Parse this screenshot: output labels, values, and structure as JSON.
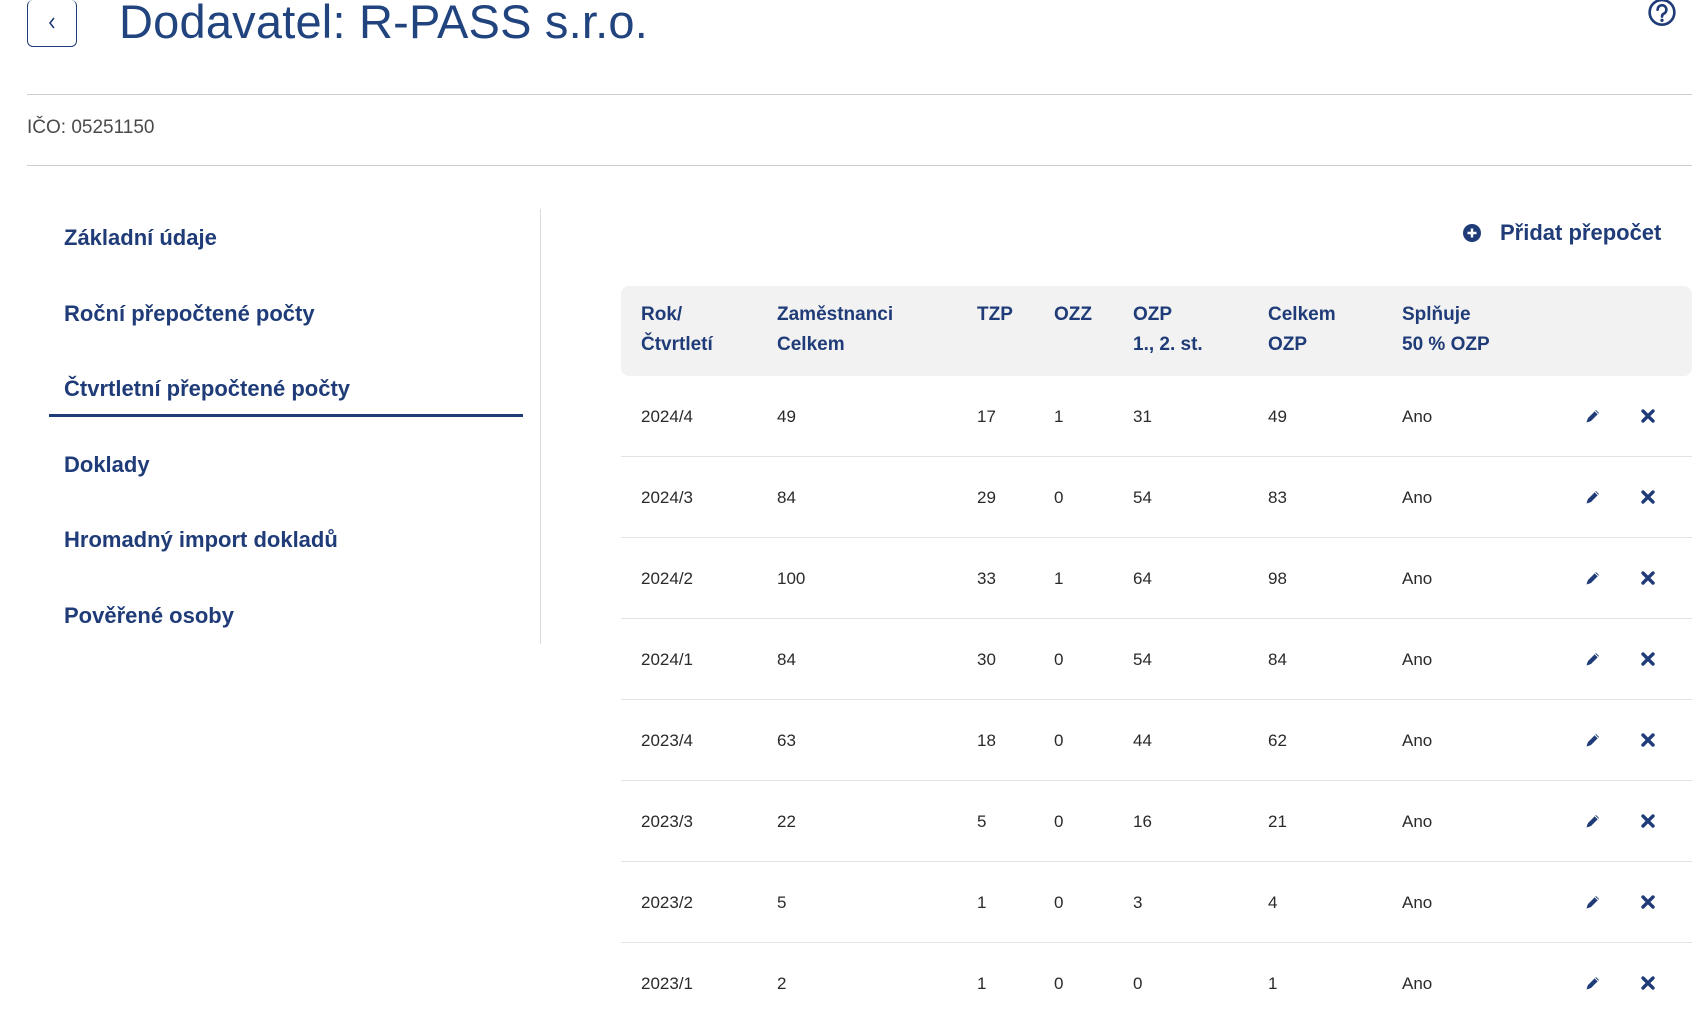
{
  "header": {
    "title": "Dodavatel: R-PASS s.r.o.",
    "ico": "IČO: 05251150"
  },
  "icons": {
    "back": "chevron-left-icon",
    "help": "question-circle-icon",
    "add": "plus-circle-icon",
    "edit": "pencil-icon",
    "delete": "close-icon"
  },
  "colors": {
    "brand": "#1f3c78",
    "header_bg": "#f2f2f2"
  },
  "sidebar": {
    "items": [
      {
        "label": "Základní údaje"
      },
      {
        "label": "Roční přepočtené počty"
      },
      {
        "label": "Čtvrtletní přepočtené počty",
        "active": true
      },
      {
        "label": "Doklady"
      },
      {
        "label": "Hromadný import dokladů"
      },
      {
        "label": "Pověřené osoby"
      }
    ]
  },
  "actions": {
    "add_label": "Přidat přepočet"
  },
  "table": {
    "columns": [
      {
        "l1": "Rok/",
        "l2": "Čtvrtletí"
      },
      {
        "l1": "Zaměstnanci",
        "l2": "Celkem"
      },
      {
        "l1": "TZP",
        "l2": ""
      },
      {
        "l1": "OZZ",
        "l2": ""
      },
      {
        "l1": "OZP",
        "l2": "1., 2. st."
      },
      {
        "l1": "Celkem",
        "l2": "OZP"
      },
      {
        "l1": "Splňuje",
        "l2": "50 % OZP"
      }
    ],
    "rows": [
      [
        "2024/4",
        "49",
        "17",
        "1",
        "31",
        "49",
        "Ano"
      ],
      [
        "2024/3",
        "84",
        "29",
        "0",
        "54",
        "83",
        "Ano"
      ],
      [
        "2024/2",
        "100",
        "33",
        "1",
        "64",
        "98",
        "Ano"
      ],
      [
        "2024/1",
        "84",
        "30",
        "0",
        "54",
        "84",
        "Ano"
      ],
      [
        "2023/4",
        "63",
        "18",
        "0",
        "44",
        "62",
        "Ano"
      ],
      [
        "2023/3",
        "22",
        "5",
        "0",
        "16",
        "21",
        "Ano"
      ],
      [
        "2023/2",
        "5",
        "1",
        "0",
        "3",
        "4",
        "Ano"
      ],
      [
        "2023/1",
        "2",
        "1",
        "0",
        "0",
        "1",
        "Ano"
      ]
    ]
  }
}
